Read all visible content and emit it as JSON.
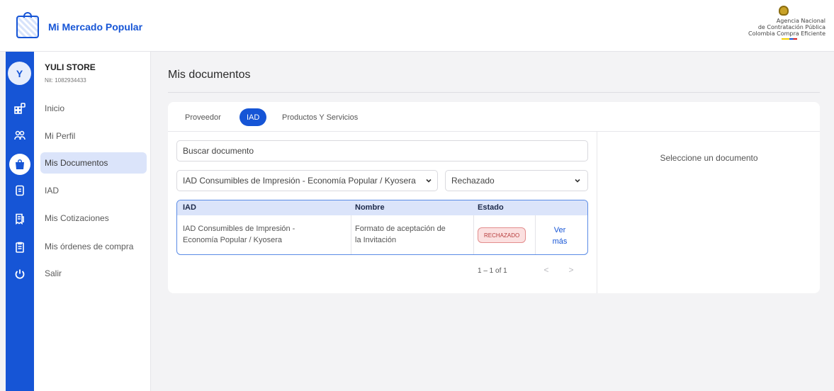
{
  "header": {
    "brand_title": "Mi Mercado Popular",
    "agency_line1": "Agencia Nacional",
    "agency_line2": "de Contratación Pública",
    "agency_line3": "Colombia Compra Eficiente"
  },
  "profile": {
    "avatar_letter": "Y",
    "store_name": "YULI STORE",
    "nit": "Nit: 1082934433"
  },
  "sidebar": {
    "items": [
      {
        "label": "Inicio",
        "icon": "grid-icon",
        "active": false
      },
      {
        "label": "Mi Perfil",
        "icon": "users-icon",
        "active": false
      },
      {
        "label": "Mis Documentos",
        "icon": "bag-icon",
        "active": true
      },
      {
        "label": "IAD",
        "icon": "document-icon",
        "active": false
      },
      {
        "label": "Mis Cotizaciones",
        "icon": "receipt-icon",
        "active": false
      },
      {
        "label": "Mis órdenes de compra",
        "icon": "clipboard-icon",
        "active": false
      },
      {
        "label": "Salir",
        "icon": "power-icon",
        "active": false
      }
    ]
  },
  "main": {
    "title": "Mis documentos",
    "tabs": [
      {
        "label": "Proveedor",
        "active": false
      },
      {
        "label": "IAD",
        "active": true
      },
      {
        "label": "Productos Y Servicios",
        "active": false
      }
    ],
    "search_value": "Buscar documento",
    "iad_select_value": "IAD Consumibles de Impresión - Economía Popular / Kyosera",
    "status_select_value": "Rechazado",
    "empty_hint": "Seleccione un documento"
  },
  "table": {
    "columns": [
      "IAD",
      "Nombre",
      "Estado"
    ],
    "rows": [
      {
        "iad_line1": "IAD Consumibles de Impresión -",
        "iad_line2": "Economía Popular / Kyosera",
        "name_line1": "Formato de aceptación de",
        "name_line2": "la Invitación",
        "status": "RECHAZADO",
        "action_line1": "Ver",
        "action_line2": "más"
      }
    ]
  },
  "pagination": {
    "label": "1 – 1 of 1",
    "prev": "<",
    "next": ">"
  },
  "colors": {
    "primary": "#1655d6",
    "active_nav_bg": "#dbe4fa",
    "rejected_bg": "#fbe0e0",
    "rejected_text": "#b73d3d"
  }
}
